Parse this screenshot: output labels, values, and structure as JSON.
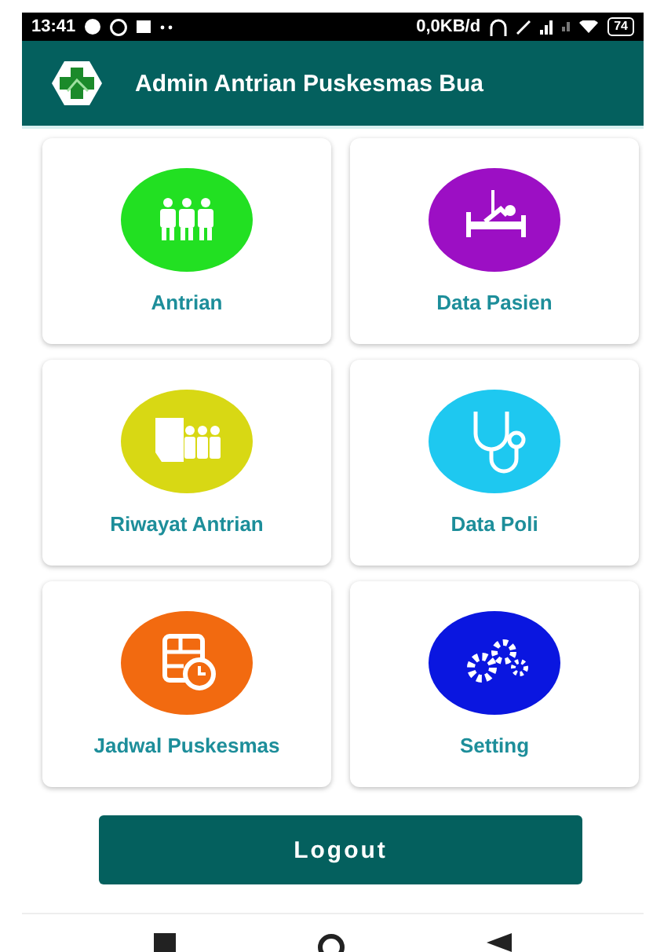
{
  "status_bar": {
    "time": "13:41",
    "speed": "0,0KB/d",
    "battery": "74"
  },
  "app_bar": {
    "title": "Admin Antrian Puskesmas Bua"
  },
  "menu": [
    {
      "label": "Antrian",
      "color": "#22e022"
    },
    {
      "label": "Data Pasien",
      "color": "#9c0fc4"
    },
    {
      "label": "Riwayat Antrian",
      "color": "#d8d814"
    },
    {
      "label": "Data Poli",
      "color": "#1ec8f0"
    },
    {
      "label": "Jadwal Puskesmas",
      "color": "#f26a10"
    },
    {
      "label": "Setting",
      "color": "#0a16e0"
    }
  ],
  "logout_button": "Logout"
}
